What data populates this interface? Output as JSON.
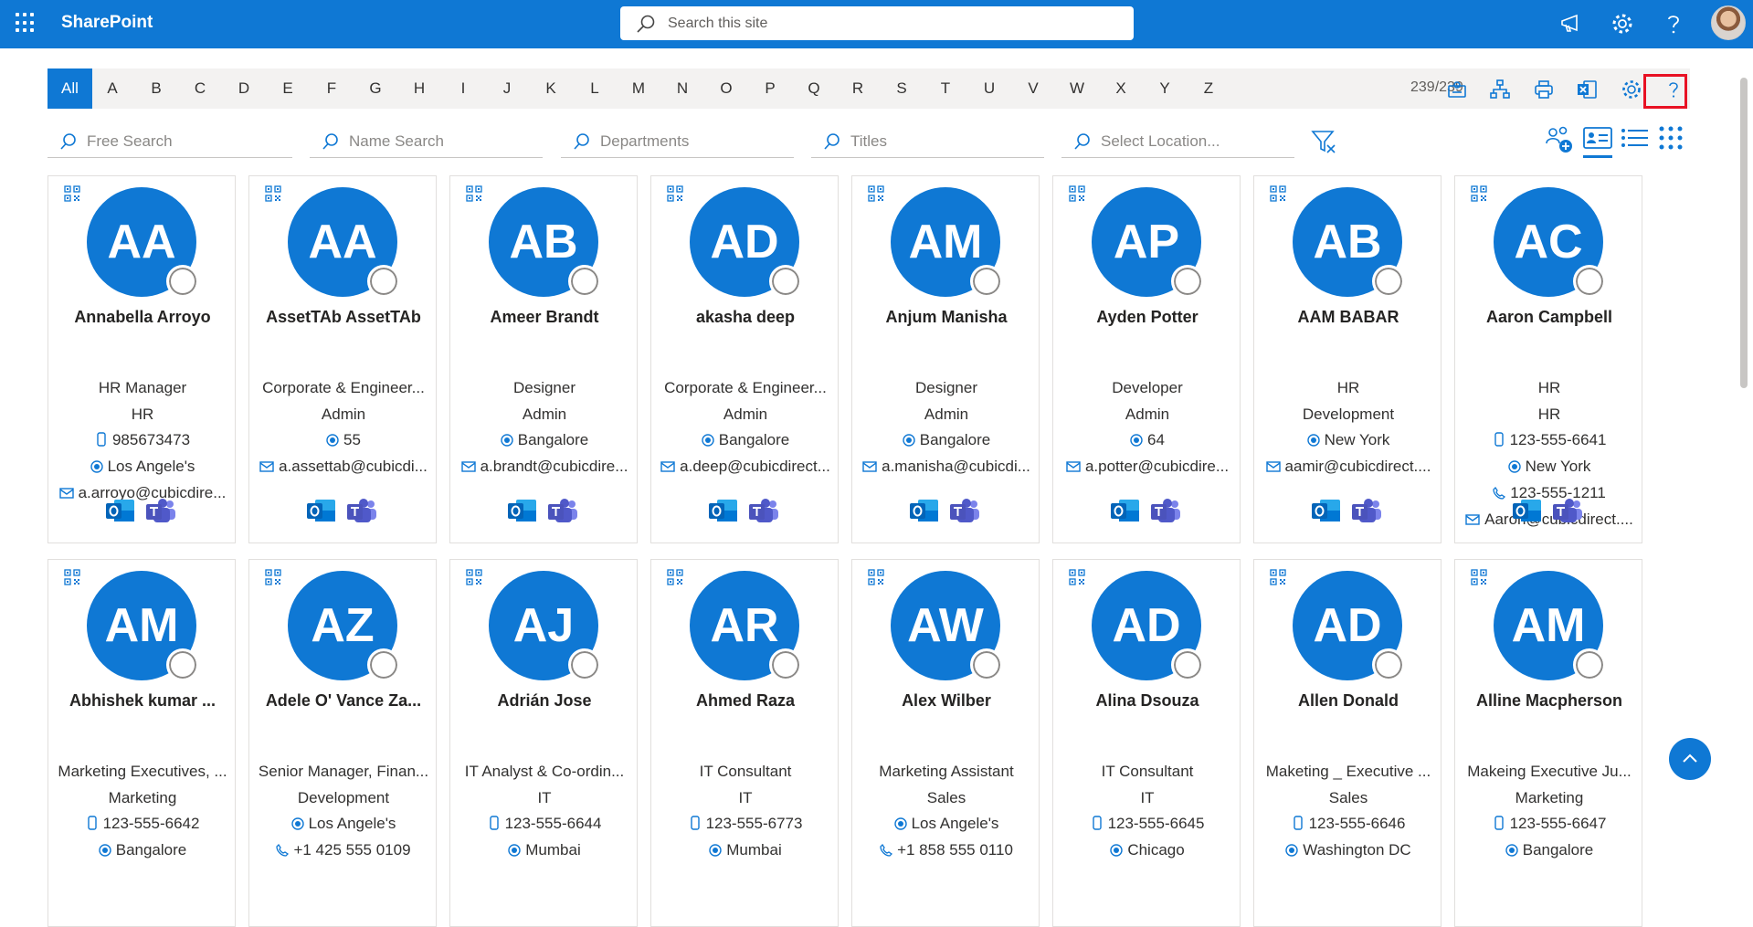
{
  "suite_bar": {
    "app_name": "SharePoint",
    "search_placeholder": "Search this site",
    "brand_color": "#0f78d4"
  },
  "alphabet": {
    "letters": [
      "All",
      "A",
      "B",
      "C",
      "D",
      "E",
      "F",
      "G",
      "H",
      "I",
      "J",
      "K",
      "L",
      "M",
      "N",
      "O",
      "P",
      "Q",
      "R",
      "S",
      "T",
      "U",
      "V",
      "W",
      "X",
      "Y",
      "Z"
    ],
    "active": "All",
    "count": "239/239"
  },
  "toolbar_icons": [
    "contact-card-icon",
    "org-chart-icon",
    "print-icon",
    "excel-export-icon",
    "settings-icon",
    "help-icon"
  ],
  "filters": {
    "free_search": "Free Search",
    "name_search": "Name Search",
    "departments": "Departments",
    "titles": "Titles",
    "location": "Select Location..."
  },
  "cards": [
    {
      "initials": "AA",
      "name": "Annabella Arroyo",
      "lines": [
        {
          "icon": "none",
          "text": "HR Manager"
        },
        {
          "icon": "none",
          "text": "HR"
        },
        {
          "icon": "phone",
          "text": "985673473"
        },
        {
          "icon": "location",
          "text": "Los Angele's"
        },
        {
          "icon": "mail",
          "text": "a.arroyo@cubicdire..."
        }
      ]
    },
    {
      "initials": "AA",
      "name": "AssetTAb AssetTAb",
      "lines": [
        {
          "icon": "none",
          "text": "Corporate & Engineer..."
        },
        {
          "icon": "none",
          "text": "Admin"
        },
        {
          "icon": "location",
          "text": "55"
        },
        {
          "icon": "mail",
          "text": "a.assettab@cubicdi..."
        }
      ]
    },
    {
      "initials": "AB",
      "name": "Ameer Brandt",
      "lines": [
        {
          "icon": "none",
          "text": "Designer"
        },
        {
          "icon": "none",
          "text": "Admin"
        },
        {
          "icon": "location",
          "text": "Bangalore"
        },
        {
          "icon": "mail",
          "text": "a.brandt@cubicdire..."
        }
      ]
    },
    {
      "initials": "AD",
      "name": "akasha deep",
      "lines": [
        {
          "icon": "none",
          "text": "Corporate & Engineer..."
        },
        {
          "icon": "none",
          "text": "Admin"
        },
        {
          "icon": "location",
          "text": "Bangalore"
        },
        {
          "icon": "mail",
          "text": "a.deep@cubicdirect..."
        }
      ]
    },
    {
      "initials": "AM",
      "name": "Anjum Manisha",
      "lines": [
        {
          "icon": "none",
          "text": "Designer"
        },
        {
          "icon": "none",
          "text": "Admin"
        },
        {
          "icon": "location",
          "text": "Bangalore"
        },
        {
          "icon": "mail",
          "text": "a.manisha@cubicdi..."
        }
      ]
    },
    {
      "initials": "AP",
      "name": "Ayden Potter",
      "lines": [
        {
          "icon": "none",
          "text": "Developer"
        },
        {
          "icon": "none",
          "text": "Admin"
        },
        {
          "icon": "location",
          "text": "64"
        },
        {
          "icon": "mail",
          "text": "a.potter@cubicdire..."
        }
      ]
    },
    {
      "initials": "AB",
      "name": "AAM BABAR",
      "lines": [
        {
          "icon": "none",
          "text": "HR"
        },
        {
          "icon": "none",
          "text": "Development"
        },
        {
          "icon": "location",
          "text": "New York"
        },
        {
          "icon": "mail",
          "text": "aamir@cubicdirect...."
        }
      ]
    },
    {
      "initials": "AC",
      "name": "Aaron Campbell",
      "lines": [
        {
          "icon": "none",
          "text": "HR"
        },
        {
          "icon": "none",
          "text": "HR"
        },
        {
          "icon": "phone",
          "text": "123-555-6641"
        },
        {
          "icon": "location",
          "text": "New York"
        },
        {
          "icon": "call",
          "text": "123-555-1211"
        },
        {
          "icon": "mail",
          "text": "Aaron@cubicdirect...."
        }
      ]
    },
    {
      "initials": "AM",
      "name": "Abhishek kumar ...",
      "lines": [
        {
          "icon": "none",
          "text": "Marketing Executives, ..."
        },
        {
          "icon": "none",
          "text": "Marketing"
        },
        {
          "icon": "phone",
          "text": "123-555-6642"
        },
        {
          "icon": "location",
          "text": "Bangalore"
        }
      ]
    },
    {
      "initials": "AZ",
      "name": "Adele O' Vance Za...",
      "lines": [
        {
          "icon": "none",
          "text": "Senior Manager, Finan..."
        },
        {
          "icon": "none",
          "text": "Development"
        },
        {
          "icon": "location",
          "text": "Los Angele's"
        },
        {
          "icon": "call",
          "text": "+1 425 555 0109"
        }
      ]
    },
    {
      "initials": "AJ",
      "name": "Adrián Jose",
      "lines": [
        {
          "icon": "none",
          "text": "IT Analyst & Co-ordin..."
        },
        {
          "icon": "none",
          "text": "IT"
        },
        {
          "icon": "phone",
          "text": "123-555-6644"
        },
        {
          "icon": "location",
          "text": "Mumbai"
        }
      ]
    },
    {
      "initials": "AR",
      "name": "Ahmed Raza",
      "lines": [
        {
          "icon": "none",
          "text": "IT Consultant"
        },
        {
          "icon": "none",
          "text": "IT"
        },
        {
          "icon": "phone",
          "text": "123-555-6773"
        },
        {
          "icon": "location",
          "text": "Mumbai"
        }
      ]
    },
    {
      "initials": "AW",
      "name": "Alex Wilber",
      "lines": [
        {
          "icon": "none",
          "text": "Marketing Assistant"
        },
        {
          "icon": "none",
          "text": "Sales"
        },
        {
          "icon": "location",
          "text": "Los Angele's"
        },
        {
          "icon": "call",
          "text": "+1 858 555 0110"
        }
      ]
    },
    {
      "initials": "AD",
      "name": "Alina Dsouza",
      "lines": [
        {
          "icon": "none",
          "text": "IT Consultant"
        },
        {
          "icon": "none",
          "text": "IT"
        },
        {
          "icon": "phone",
          "text": "123-555-6645"
        },
        {
          "icon": "location",
          "text": "Chicago"
        }
      ]
    },
    {
      "initials": "AD",
      "name": "Allen Donald",
      "lines": [
        {
          "icon": "none",
          "text": "Maketing _ Executive ..."
        },
        {
          "icon": "none",
          "text": "Sales"
        },
        {
          "icon": "phone",
          "text": "123-555-6646"
        },
        {
          "icon": "location",
          "text": "Washington DC"
        }
      ]
    },
    {
      "initials": "AM",
      "name": "Alline Macpherson",
      "lines": [
        {
          "icon": "none",
          "text": "Makeing Executive Ju..."
        },
        {
          "icon": "none",
          "text": "Marketing"
        },
        {
          "icon": "phone",
          "text": "123-555-6647"
        },
        {
          "icon": "location",
          "text": "Bangalore"
        }
      ]
    }
  ]
}
